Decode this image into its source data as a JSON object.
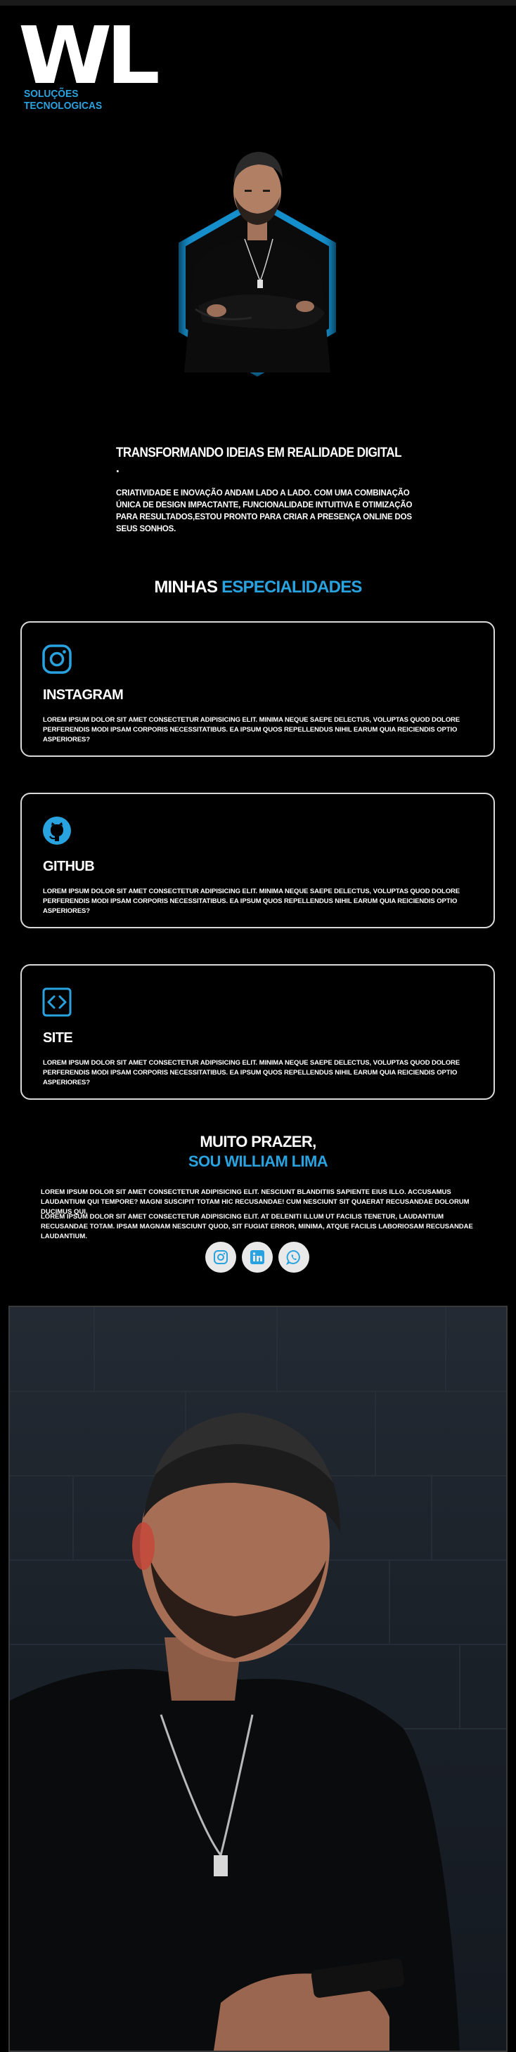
{
  "brand": {
    "logo_text": "WL",
    "tagline": "SOLUÇÕES TECNOLOGICAS"
  },
  "hero": {
    "headline": "TRANSFORMANDO IDEIAS EM REALIDADE DIGITAL .",
    "intro": "CRIATIVIDADE E INOVAÇÃO ANDAM LADO A LADO. COM UMA COMBINAÇÃO ÚNICA DE DESIGN IMPACTANTE, FUNCIONALIDADE INTUITIVA E OTIMIZAÇÃO PARA RESULTADOS,ESTOU PRONTO PARA CRIAR A PRESENÇA ONLINE DOS SEUS SONHOS."
  },
  "specialties": {
    "title_prefix": "MINHAS",
    "title_accent": "ESPECIALIDADES",
    "cards": [
      {
        "icon": "instagram-icon",
        "title": "INSTAGRAM",
        "text": "LOREM IPSUM DOLOR SIT AMET CONSECTETUR ADIPISICING ELIT. MINIMA NEQUE SAEPE DELECTUS, VOLUPTAS QUOD DOLORE PERFERENDIS MODI IPSAM CORPORIS NECESSITATIBUS. EA IPSUM QUOS REPELLENDUS NIHIL EARUM QUIA REICIENDIS OPTIO ASPERIORES?"
      },
      {
        "icon": "github-icon",
        "title": "GITHUB",
        "text": "LOREM IPSUM DOLOR SIT AMET CONSECTETUR ADIPISICING ELIT. MINIMA NEQUE SAEPE DELECTUS, VOLUPTAS QUOD DOLORE PERFERENDIS MODI IPSAM CORPORIS NECESSITATIBUS. EA IPSUM QUOS REPELLENDUS NIHIL EARUM QUIA REICIENDIS OPTIO ASPERIORES?"
      },
      {
        "icon": "code-icon",
        "title": "SITE",
        "text": "LOREM IPSUM DOLOR SIT AMET CONSECTETUR ADIPISICING ELIT. MINIMA NEQUE SAEPE DELECTUS, VOLUPTAS QUOD DOLORE PERFERENDIS MODI IPSAM CORPORIS NECESSITATIBUS. EA IPSUM QUOS REPELLENDUS NIHIL EARUM QUIA REICIENDIS OPTIO ASPERIORES?"
      }
    ]
  },
  "about": {
    "greeting": "MUITO PRAZER,",
    "name_line": "SOU WILLIAM LIMA",
    "paragraph_1": "LOREM IPSUM DOLOR SIT AMET CONSECTETUR ADIPISICING ELIT. NESCIUNT BLANDITIIS SAPIENTE EIUS ILLO. ACCUSAMUS LAUDANTIUM QUI TEMPORE? MAGNI SUSCIPIT TOTAM HIC RECUSANDAE! CUM NESCIUNT SIT QUAERAT RECUSANDAE DOLORUM DUCIMUS QUI.",
    "paragraph_2": "LOREM IPSUM DOLOR SIT AMET CONSECTETUR ADIPISICING ELIT. AT DELENITI ILLUM UT FACILIS TENETUR, LAUDANTIUM RECUSANDAE TOTAM. IPSAM MAGNAM NESCIUNT QUOD, SIT FUGIAT ERROR, MINIMA, ATQUE FACILIS LABORIOSAM RECUSANDAE LAUDANTIUM.",
    "social": [
      "instagram-icon",
      "linkedin-icon",
      "whatsapp-icon"
    ]
  },
  "colors": {
    "accent": "#29a3e0",
    "background": "#000000",
    "card_border": "#d9d9d9",
    "glow": "#19a8f0"
  }
}
